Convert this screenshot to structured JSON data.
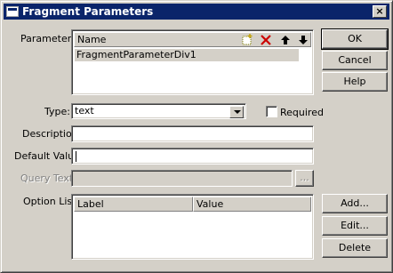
{
  "window": {
    "title": "Fragment Parameters",
    "close_glyph": "×"
  },
  "labels": {
    "parameters": "Parameters:",
    "type": "Type:",
    "required": "Required",
    "description": "Description:",
    "default_value": "Default Value:",
    "query_text": "Query Text:",
    "option_list": "Option List:"
  },
  "parameters_list": {
    "header": "Name",
    "items": [
      "FragmentParameterDiv1"
    ],
    "toolbar_icons": [
      "new-icon",
      "delete-icon",
      "move-up-icon",
      "move-down-icon"
    ]
  },
  "fields": {
    "type_value": "text",
    "required_checked": false,
    "description_value": "",
    "default_value": "",
    "query_text_value": "",
    "query_browse_label": "..."
  },
  "option_list": {
    "columns": [
      "Label",
      "Value"
    ],
    "rows": []
  },
  "buttons": {
    "ok": "OK",
    "cancel": "Cancel",
    "help": "Help",
    "add": "Add...",
    "edit": "Edit...",
    "delete": "Delete"
  },
  "colors": {
    "titlebar": "#0a246a",
    "face": "#d4d0c8",
    "delete_icon": "#cc0000"
  }
}
